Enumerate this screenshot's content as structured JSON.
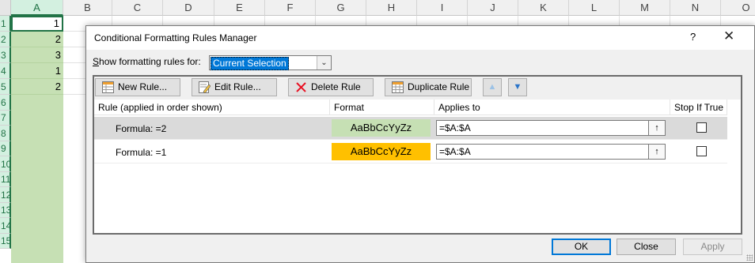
{
  "sheet": {
    "columns": [
      "A",
      "B",
      "C",
      "D",
      "E",
      "F",
      "G",
      "H",
      "I",
      "J",
      "K",
      "L",
      "M",
      "N",
      "O"
    ],
    "rows": [
      "1",
      "2",
      "3",
      "4",
      "5",
      "6",
      "7",
      "8",
      "9",
      "10",
      "11",
      "12",
      "13",
      "14",
      "15"
    ],
    "column_a_values": [
      "1",
      "2",
      "3",
      "1",
      "2"
    ],
    "selected_column": "A",
    "highlight_color": "#c6e0b4"
  },
  "dialog": {
    "title": "Conditional Formatting Rules Manager",
    "help": "?",
    "close": "✕",
    "show_rules_label": "Show formatting rules for:",
    "show_rules_value": "Current Selection",
    "toolbar": {
      "new_rule": "New Rule...",
      "edit_rule": "Edit Rule...",
      "delete_rule": "Delete Rule",
      "duplicate_rule": "Duplicate Rule",
      "move_up": "▲",
      "move_down": "▼"
    },
    "columns": {
      "rule": "Rule (applied in order shown)",
      "format": "Format",
      "applies_to": "Applies to",
      "stop_if_true": "Stop If True"
    },
    "rules": [
      {
        "name": "Formula: =2",
        "format_preview": "AaBbCcYyZz",
        "format_color": "#c6e0b4",
        "applies_to": "=$A:$A",
        "stop_if_true": false,
        "selected": true
      },
      {
        "name": "Formula: =1",
        "format_preview": "AaBbCcYyZz",
        "format_color": "#ffc000",
        "applies_to": "=$A:$A",
        "stop_if_true": false,
        "selected": false
      }
    ],
    "buttons": {
      "ok": "OK",
      "close": "Close",
      "apply": "Apply"
    }
  }
}
